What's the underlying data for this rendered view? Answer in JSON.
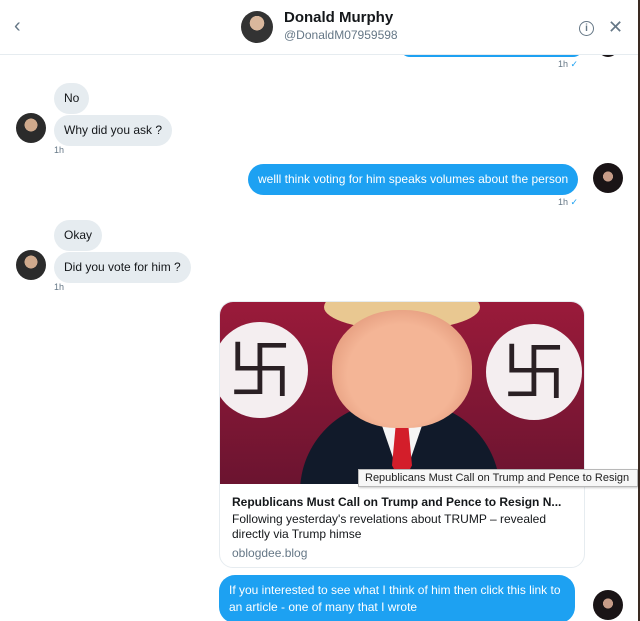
{
  "header": {
    "name": "Donald Murphy",
    "handle": "@DonaldM07959598",
    "back_icon": "‹",
    "info_icon": "i",
    "close_icon": "✕"
  },
  "top_receipt": {
    "time": "1h",
    "check": "✓"
  },
  "messages": [
    {
      "side": "in",
      "text": "No"
    },
    {
      "side": "in",
      "text": "Why did you ask ?",
      "time": "1h"
    },
    {
      "side": "out",
      "text": "welll think voting for him speaks volumes about the person",
      "time": "1h",
      "check": "✓"
    },
    {
      "side": "in",
      "text": "Okay"
    },
    {
      "side": "in",
      "text": "Did you vote for him ?",
      "time": "1h"
    }
  ],
  "card": {
    "title": "Republicans Must Call on Trump and Pence to Resign N...",
    "description": "Following yesterday's revelations about TRUMP – revealed directly via Trump himse",
    "link": "oblogdee.blog"
  },
  "tooltip": "Republicans Must Call on Trump and Pence to Resign",
  "last_message": {
    "side": "out",
    "text": "If you interested to see what I think of him then click this link to an article - one of many that I wrote"
  },
  "colors": {
    "accent": "#1da1f2",
    "incoming": "#e6ecf0"
  }
}
